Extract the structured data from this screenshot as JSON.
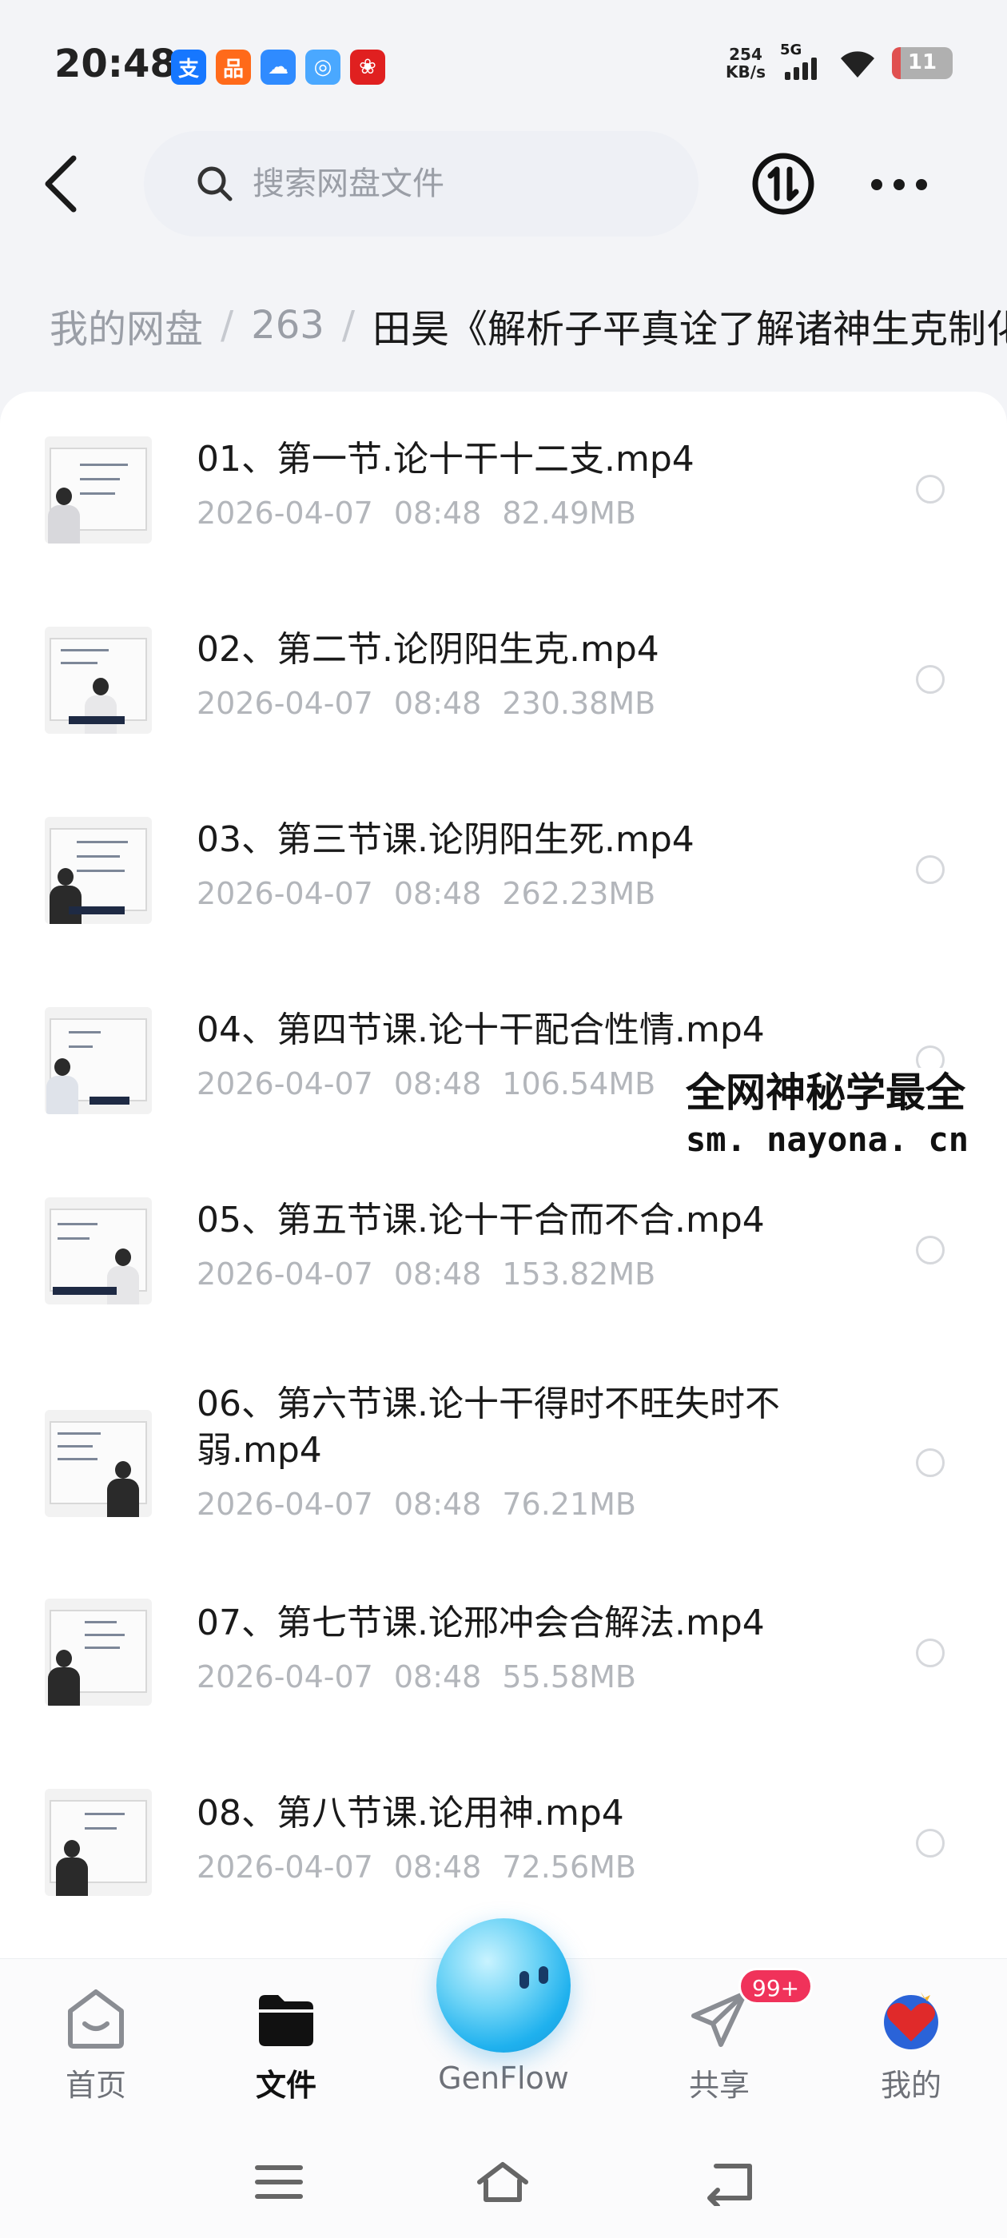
{
  "status_bar": {
    "time": "20:48",
    "net_speed_value": "254",
    "net_speed_unit": "KB/s",
    "network_type": "5G",
    "battery_level": "11",
    "apps": [
      {
        "name": "alipay-icon",
        "glyph": "支",
        "color": "#1677ff"
      },
      {
        "name": "app-orange-icon",
        "glyph": "品",
        "color": "#ff6a1a"
      },
      {
        "name": "cloud-app-icon",
        "glyph": "☁",
        "color": "#2f8bff"
      },
      {
        "name": "genflow-app-icon",
        "glyph": "◎",
        "color": "#4aa8ff"
      },
      {
        "name": "pinduoduo-icon",
        "glyph": "❀",
        "color": "#e02020"
      }
    ]
  },
  "search": {
    "placeholder": "搜索网盘文件"
  },
  "breadcrumb": {
    "root": "我的网盘",
    "sep": "/",
    "folder": "263",
    "current": "田昊《解析子平真诠了解诸神生克制化"
  },
  "files": [
    {
      "title": "01、第一节.论十干十二支.mp4",
      "date": "2026-04-07",
      "time": "08:48",
      "size": "82.49MB"
    },
    {
      "title": "02、第二节.论阴阳生克.mp4",
      "date": "2026-04-07",
      "time": "08:48",
      "size": "230.38MB"
    },
    {
      "title": "03、第三节课.论阴阳生死.mp4",
      "date": "2026-04-07",
      "time": "08:48",
      "size": "262.23MB"
    },
    {
      "title": "04、第四节课.论十干配合性情.mp4",
      "date": "2026-04-07",
      "time": "08:48",
      "size": "106.54MB"
    },
    {
      "title": "05、第五节课.论十干合而不合.mp4",
      "date": "2026-04-07",
      "time": "08:48",
      "size": "153.82MB"
    },
    {
      "title": "06、第六节课.论十干得时不旺失时不弱.mp4",
      "date": "2026-04-07",
      "time": "08:48",
      "size": "76.21MB"
    },
    {
      "title": "07、第七节课.论邢冲会合解法.mp4",
      "date": "2026-04-07",
      "time": "08:48",
      "size": "55.58MB"
    },
    {
      "title": "08、第八节课.论用神.mp4",
      "date": "2026-04-07",
      "time": "08:48",
      "size": "72.56MB"
    }
  ],
  "watermark": {
    "line1": "全网神秘学最全",
    "line2": "sm. nayona. cn"
  },
  "bottom_nav": {
    "home": "首页",
    "files": "文件",
    "genflow": "GenFlow",
    "share": "共享",
    "share_badge": "99+",
    "mine": "我的"
  },
  "colors": {
    "accent_orb": "#1fb1ee",
    "badge": "#f0325a",
    "muted_text": "#9a9ea6"
  }
}
